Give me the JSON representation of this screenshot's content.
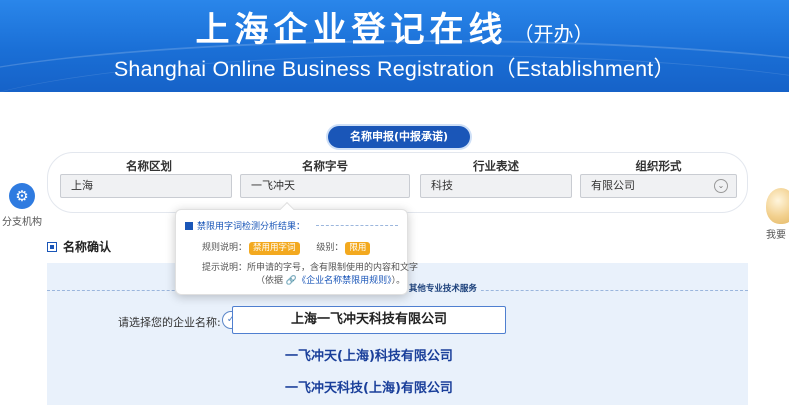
{
  "banner": {
    "title_cn": "上海企业登记在线",
    "title_cn_sub": "（开办）",
    "title_en": "Shanghai Online Business Registration（Establishment）"
  },
  "sidebar_left": {
    "icon": "gear-icon",
    "label": "分支机构"
  },
  "sidebar_right": {
    "icon": "assistant-avatar-icon",
    "label": "我要"
  },
  "step_pill": "名称申报(中报承诺)",
  "form": {
    "columns": [
      {
        "header": "名称区划",
        "value": "上海"
      },
      {
        "header": "名称字号",
        "value": "一飞冲天"
      },
      {
        "header": "行业表述",
        "value": "科技"
      },
      {
        "header": "组织形式",
        "value": "有限公司"
      }
    ]
  },
  "tooltip": {
    "title": "禁限用字词检测分析结果：",
    "rule_label": "规则说明：",
    "rule_tag": "禁用用字词",
    "level_label": "级别：",
    "level_tag": "限用",
    "hint_label": "提示说明：",
    "hint_text": "所申请的字号，含有限制使用的内容和文字",
    "hint_prefix": "（依据",
    "hint_link": "《企业名称禁限用规则》",
    "hint_suffix": "）。"
  },
  "section": {
    "title": "名称确认"
  },
  "panel": {
    "divider_text": ") 其他专业技术服务",
    "choose_label": "请选择您的企业名称:",
    "options": [
      "上海一飞冲天科技有限公司",
      "一飞冲天(上海)科技有限公司",
      "一飞冲天科技(上海)有限公司"
    ]
  },
  "colors": {
    "banner": "#1a6fd6",
    "accent": "#1a56b8",
    "tag": "#f3a91f",
    "panel": "#e9f1fb"
  }
}
